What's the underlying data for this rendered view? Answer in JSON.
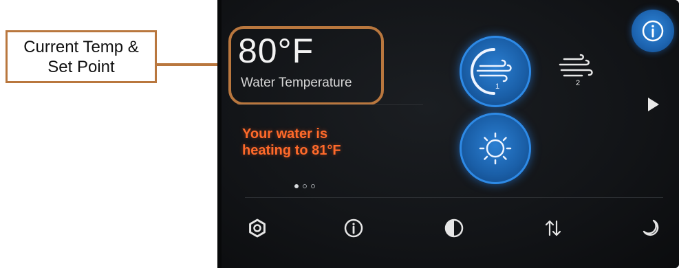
{
  "annotation": {
    "line1": "Current Temp &",
    "line2": "Set Point",
    "color": "#b9773e"
  },
  "status": {
    "temperature": "80°F",
    "label": "Water Temperature",
    "message_line1": "Your water is",
    "message_line2": "heating to 81°F",
    "message_color": "#ff6a2a"
  },
  "controls": {
    "fan1_badge": "1",
    "fan2_badge": "2",
    "accent": "#1f6cc0"
  },
  "pager": {
    "pages": 3,
    "active": 1
  },
  "toolbar": {
    "icons": [
      "gear-icon",
      "info-icon",
      "contrast-icon",
      "sort-arrows-icon",
      "moon-icon"
    ]
  }
}
